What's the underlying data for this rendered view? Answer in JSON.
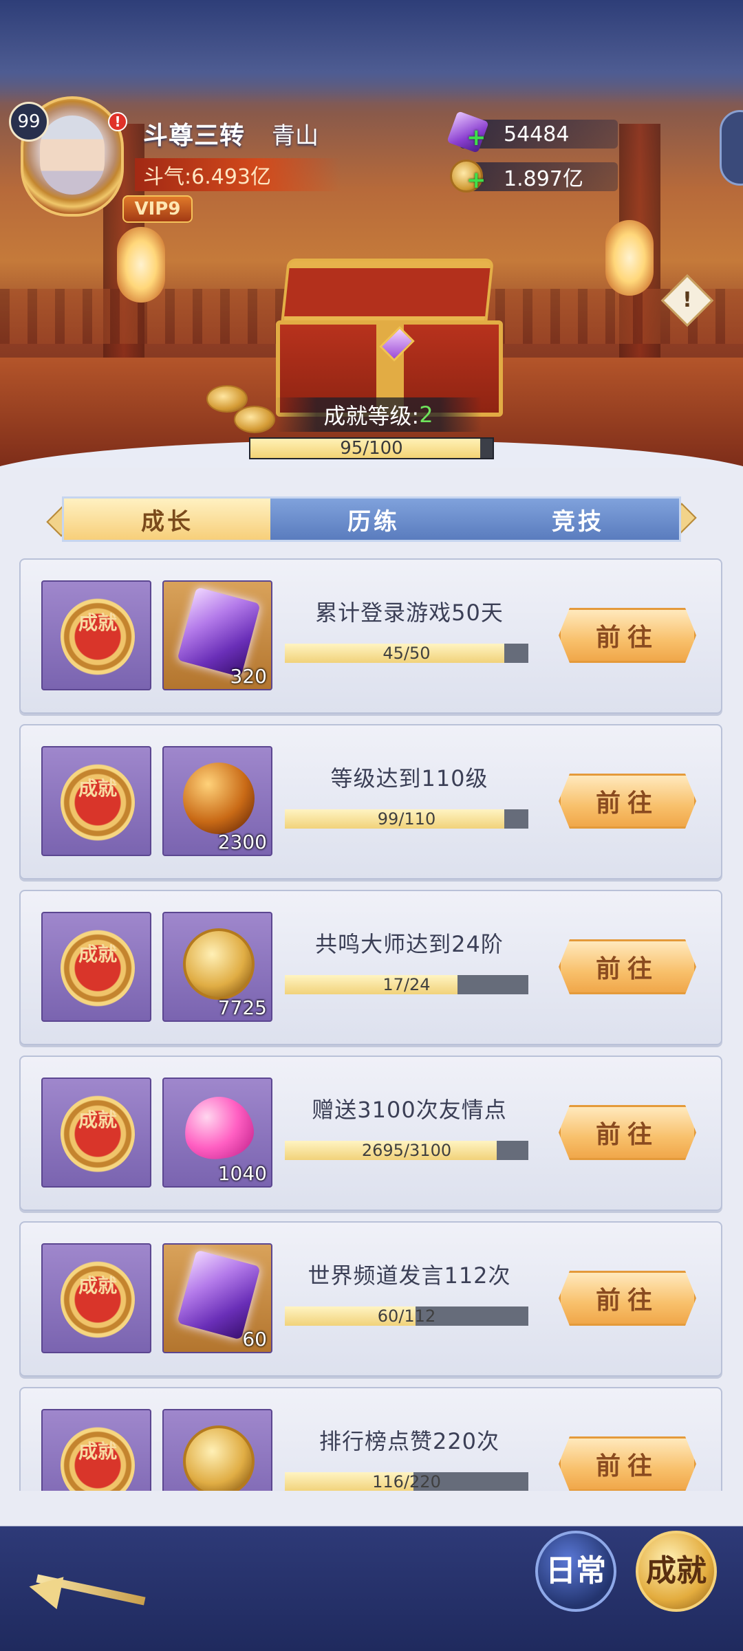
{
  "player": {
    "level": "99",
    "rank_title": "斗尊三转",
    "name": "青山",
    "power": "斗气:6.493亿",
    "vip": "VIP9",
    "alert": "!"
  },
  "currency": {
    "gems": "54484",
    "gold": "1.897亿"
  },
  "achievement": {
    "level_label": "成就等级:",
    "level_value": "2",
    "progress_text": "95/100",
    "progress": 0.95
  },
  "tabs": [
    {
      "label": "成长",
      "active": true
    },
    {
      "label": "历练",
      "active": false
    },
    {
      "label": "竞技",
      "active": false
    }
  ],
  "medal_text": "成就",
  "go_label": "前往",
  "tasks": [
    {
      "title": "累计登录游戏50天",
      "progress_text": "45/50",
      "progress": 0.9,
      "reward_qty": "320",
      "reward_icon": "purple-crystal-icon"
    },
    {
      "title": "等级达到110级",
      "progress_text": "99/110",
      "progress": 0.9,
      "reward_qty": "2300",
      "reward_icon": "fire-orb-icon"
    },
    {
      "title": "共鸣大师达到24阶",
      "progress_text": "17/24",
      "progress": 0.708,
      "reward_qty": "7725",
      "reward_icon": "gold-coin-icon"
    },
    {
      "title": "赠送3100次友情点",
      "progress_text": "2695/3100",
      "progress": 0.869,
      "reward_qty": "1040",
      "reward_icon": "pink-heart-icon"
    },
    {
      "title": "世界频道发言112次",
      "progress_text": "60/112",
      "progress": 0.536,
      "reward_qty": "60",
      "reward_icon": "purple-crystal-icon"
    },
    {
      "title": "排行榜点赞220次",
      "progress_text": "116/220",
      "progress": 0.527,
      "reward_qty": "",
      "reward_icon": "gold-coin-icon"
    }
  ],
  "bottom": {
    "daily_label": "日常",
    "achievement_label": "成就"
  }
}
